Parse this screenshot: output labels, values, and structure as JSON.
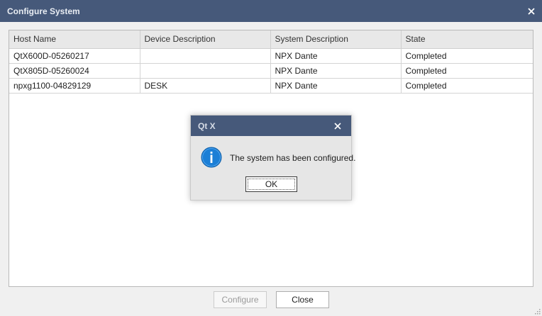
{
  "window": {
    "title": "Configure System",
    "close_icon": "close-icon"
  },
  "grid": {
    "columns": [
      "Host Name",
      "Device Description",
      "System Description",
      "State"
    ],
    "rows": [
      [
        "QtX600D-05260217",
        "",
        "NPX Dante",
        "Completed"
      ],
      [
        "QtX805D-05260024",
        "",
        "NPX Dante",
        "Completed"
      ],
      [
        "npxg1100-04829129",
        "DESK",
        "NPX Dante",
        "Completed"
      ]
    ]
  },
  "buttons": {
    "configure_label": "Configure",
    "close_label": "Close"
  },
  "dialog": {
    "title": "Qt X",
    "message": "The system has been configured.",
    "ok_label": "OK",
    "icon": "info-icon"
  },
  "colors": {
    "titlebar": "#46597a",
    "info_blue": "#1c7fd6"
  }
}
